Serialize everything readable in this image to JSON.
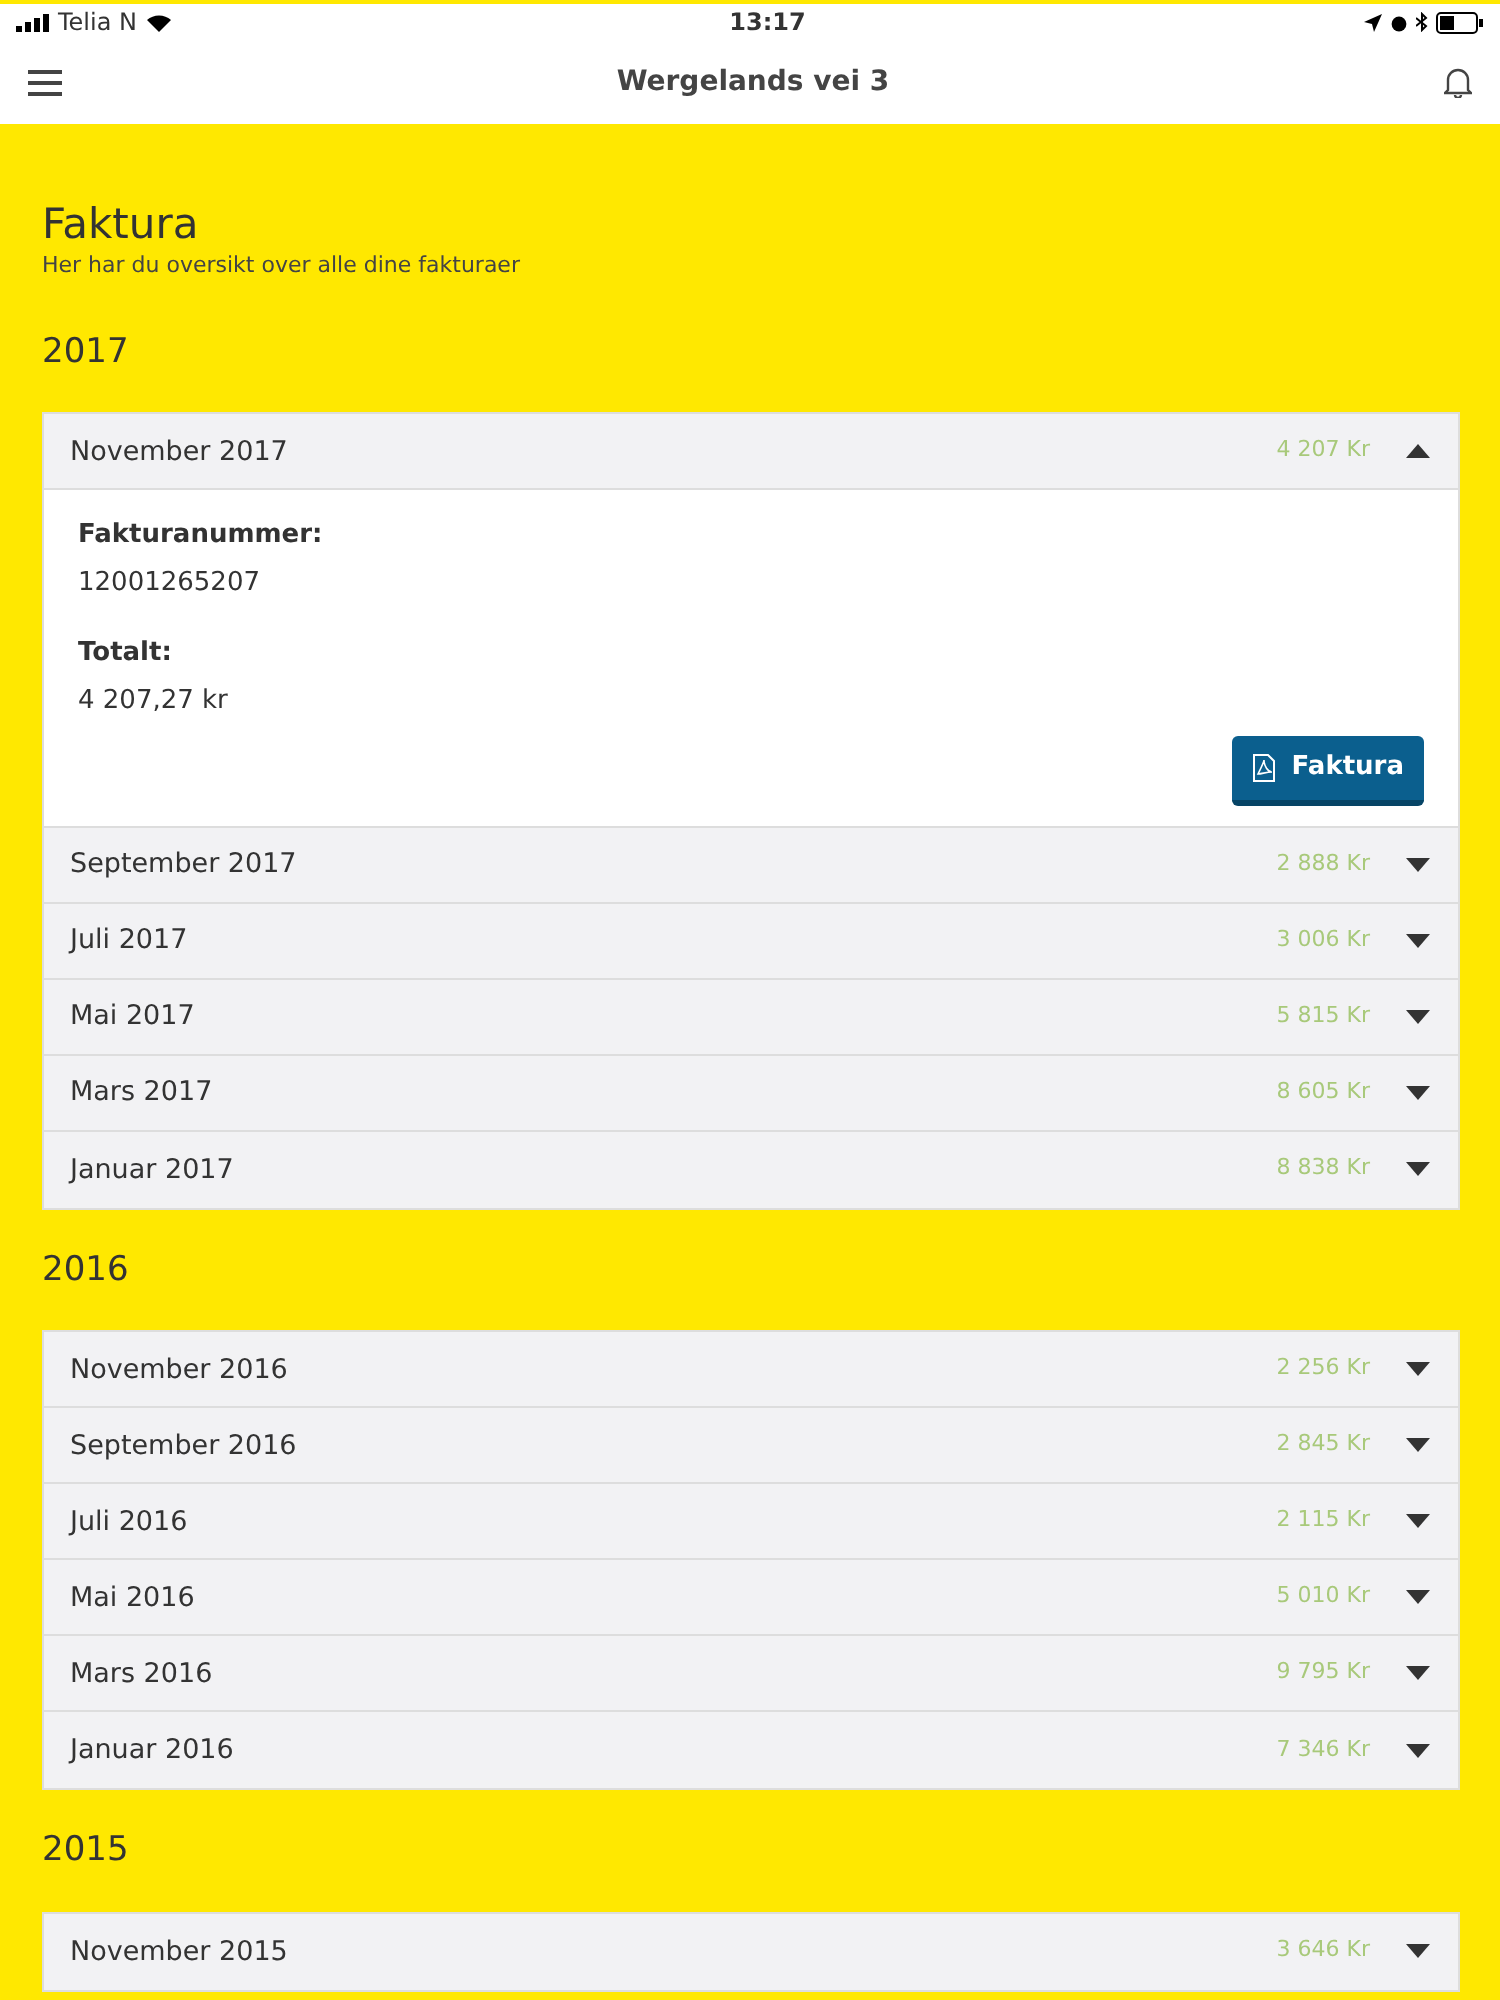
{
  "status_bar": {
    "carrier": "Telia N",
    "time": "13:17"
  },
  "header": {
    "title": "Wergelands vei 3"
  },
  "page": {
    "title": "Faktura",
    "subtitle": "Her har du oversikt over alle dine fakturaer"
  },
  "years": [
    {
      "year": "2017",
      "invoices": [
        {
          "month": "November 2017",
          "amount": "4 207 Kr",
          "expanded": true,
          "details": [
            {
              "label": "Fakturanummer:",
              "value": "12001265207"
            },
            {
              "label": "Totalt:",
              "value": "4 207,27 kr"
            }
          ],
          "button": "Faktura"
        },
        {
          "month": "September 2017",
          "amount": "2 888 Kr",
          "expanded": false
        },
        {
          "month": "Juli 2017",
          "amount": "3 006 Kr",
          "expanded": false
        },
        {
          "month": "Mai 2017",
          "amount": "5 815 Kr",
          "expanded": false
        },
        {
          "month": "Mars 2017",
          "amount": "8 605 Kr",
          "expanded": false
        },
        {
          "month": "Januar 2017",
          "amount": "8 838 Kr",
          "expanded": false
        }
      ]
    },
    {
      "year": "2016",
      "invoices": [
        {
          "month": "November 2016",
          "amount": "2 256 Kr",
          "expanded": false
        },
        {
          "month": "September 2016",
          "amount": "2 845 Kr",
          "expanded": false
        },
        {
          "month": "Juli 2016",
          "amount": "2 115 Kr",
          "expanded": false
        },
        {
          "month": "Mai 2016",
          "amount": "5 010 Kr",
          "expanded": false
        },
        {
          "month": "Mars 2016",
          "amount": "9 795 Kr",
          "expanded": false
        },
        {
          "month": "Januar 2016",
          "amount": "7 346 Kr",
          "expanded": false
        }
      ]
    },
    {
      "year": "2015",
      "invoices": [
        {
          "month": "November 2015",
          "amount": "3 646 Kr",
          "expanded": false
        }
      ]
    }
  ]
}
